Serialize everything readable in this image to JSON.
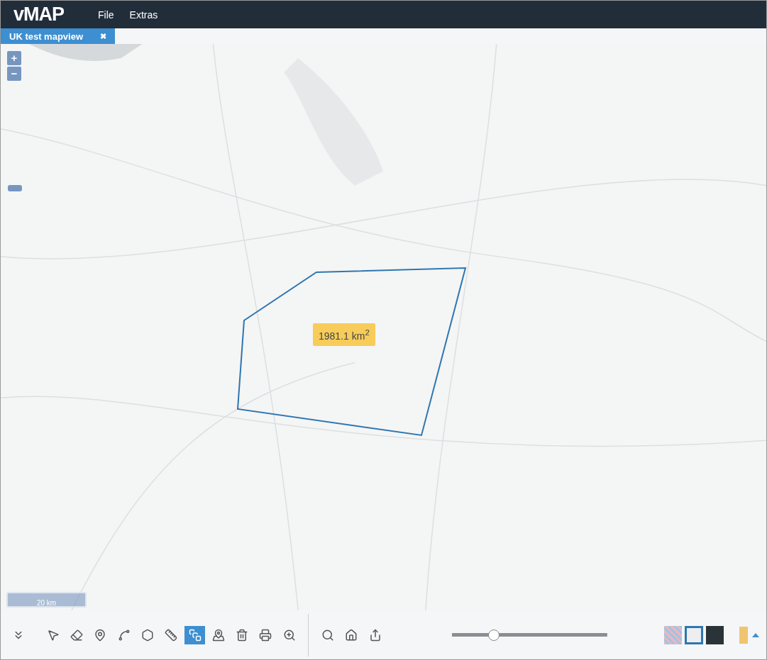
{
  "app": {
    "logo": "vMAP",
    "menu": [
      "File",
      "Extras"
    ]
  },
  "tabs": [
    {
      "label": "UK test mapview",
      "selected": true,
      "close": "✖"
    }
  ],
  "map": {
    "zoom_buttons": [
      "+",
      "−"
    ],
    "measurement": "1981.1 km$^{2}$",
    "scale": "20 km"
  },
  "toolbar": {
    "tools": [
      {
        "selected": false
      },
      {
        "selected": false
      },
      {
        "selected": false
      },
      {
        "selected": false
      },
      {
        "selected": false
      },
      {
        "selected": false
      },
      {
        "selected": false
      },
      {
        "selected": true
      },
      {
        "selected": false
      },
      {
        "selected": false
      },
      {
        "selected": false
      },
      {
        "selected": false
      }
    ],
    "nav_tools": [
      {
        "selected": false
      },
      {
        "selected": false
      },
      {
        "selected": false
      }
    ],
    "opacity": {
      "level": 0.27
    },
    "basemaps": [
      {
        "selected": false
      },
      {
        "selected": true
      },
      {
        "selected": false
      }
    ],
    "layer_color": {
      "color": "#f0c470"
    }
  }
}
